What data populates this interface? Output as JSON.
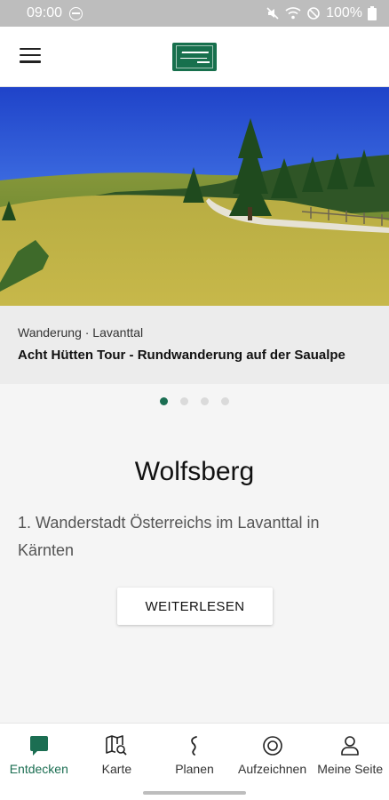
{
  "status_bar": {
    "time": "09:00",
    "battery": "100%"
  },
  "hero": {
    "category": "Wanderung · Lavanttal",
    "title": "Acht Hütten Tour -  Rundwanderung auf der Saualpe"
  },
  "carousel": {
    "count": 4,
    "active_index": 0
  },
  "intro": {
    "headline": "Wolfsberg",
    "description": "1. Wanderstadt Österreichs im Lavanttal in Kärnten",
    "read_more_label": "WEITERLESEN"
  },
  "bottom_nav": {
    "items": [
      {
        "label": "Entdecken",
        "icon": "chat-bubble-icon",
        "active": true
      },
      {
        "label": "Karte",
        "icon": "map-search-icon",
        "active": false
      },
      {
        "label": "Planen",
        "icon": "route-icon",
        "active": false
      },
      {
        "label": "Aufzeichnen",
        "icon": "record-icon",
        "active": false
      },
      {
        "label": "Meine Seite",
        "icon": "person-icon",
        "active": false
      }
    ]
  },
  "colors": {
    "accent": "#1b6e52",
    "logo_green": "#17704d",
    "status_bar": "#bdbdbd"
  }
}
